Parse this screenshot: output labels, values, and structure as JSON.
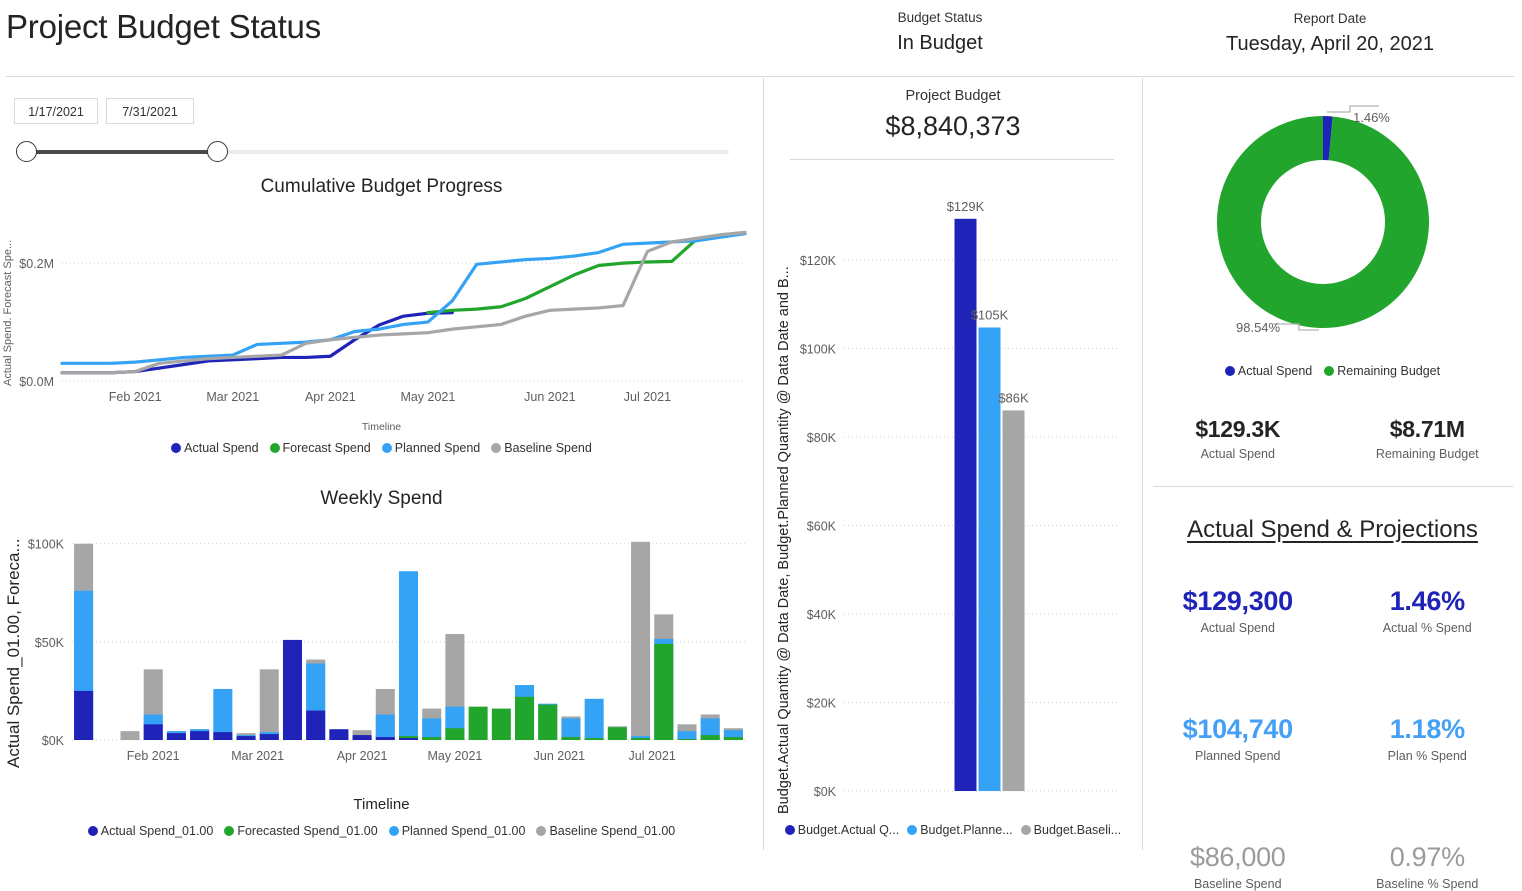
{
  "header": {
    "title": "Project Budget Status",
    "budget_status_label": "Budget Status",
    "budget_status_value": "In Budget",
    "report_date_label": "Report Date",
    "report_date_value": "Tuesday, April 20, 2021"
  },
  "slicer": {
    "start_date": "1/17/2021",
    "end_date": "7/31/2021"
  },
  "colors": {
    "actual": "#1f23b8",
    "forecast": "#21a52c",
    "planned": "#34a3f5",
    "baseline": "#a6a6a6",
    "text": "#252423",
    "muted": "#605e5c"
  },
  "middle": {
    "kpi_label": "Project Budget",
    "kpi_value": "$8,840,373"
  },
  "right": {
    "donut_label_top": "1.46%",
    "donut_label_bottom": "98.54%",
    "kpi_top": [
      {
        "value": "$129.3K",
        "label": "Actual Spend"
      },
      {
        "value": "$8.71M",
        "label": "Remaining Budget"
      }
    ],
    "projections_title": "Actual Spend & Projections",
    "projections": [
      [
        {
          "value": "$129,300",
          "label": "Actual Spend"
        },
        {
          "value": "1.46%",
          "label": "Actual % Spend"
        }
      ],
      [
        {
          "value": "$104,740",
          "label": "Planned Spend"
        },
        {
          "value": "1.18%",
          "label": "Plan % Spend"
        }
      ],
      [
        {
          "value": "$86,000",
          "label": "Baseline Spend"
        },
        {
          "value": "0.97%",
          "label": "Baseline % Spend"
        }
      ]
    ]
  },
  "chart_data": [
    {
      "id": "cumulative",
      "type": "line",
      "title": "Cumulative Budget Progress",
      "xlabel": "Timeline",
      "ylabel": "Actual Spend. Forecast Spe...",
      "x_ticks": [
        "Feb 2021",
        "Mar 2021",
        "Apr 2021",
        "May 2021",
        "Jun 2021",
        "Jul 2021"
      ],
      "y_ticks": [
        "$0.0M",
        "$0.2M"
      ],
      "ylim": [
        0,
        280000
      ],
      "y_tick_values": [
        0,
        200000
      ],
      "grid": true,
      "legend_position": "bottom",
      "x": [
        "2021-01-17",
        "2021-01-24",
        "2021-01-31",
        "2021-02-07",
        "2021-02-14",
        "2021-02-21",
        "2021-02-28",
        "2021-03-07",
        "2021-03-14",
        "2021-03-21",
        "2021-03-28",
        "2021-04-04",
        "2021-04-11",
        "2021-04-18",
        "2021-04-25",
        "2021-05-02",
        "2021-05-09",
        "2021-05-16",
        "2021-05-23",
        "2021-05-30",
        "2021-06-06",
        "2021-06-13",
        "2021-06-20",
        "2021-06-27",
        "2021-07-04",
        "2021-07-11",
        "2021-07-18",
        "2021-07-25",
        "2021-07-31"
      ],
      "series": [
        {
          "name": "Actual Spend",
          "color": "#1f23b8",
          "values": [
            14000,
            14000,
            14000,
            16000,
            22000,
            28000,
            34000,
            36000,
            38000,
            40000,
            40000,
            42000,
            70000,
            95000,
            110000,
            115000,
            116000,
            null,
            null,
            null,
            null,
            null,
            null,
            null,
            null,
            null,
            null,
            null,
            null
          ]
        },
        {
          "name": "Forecast Spend",
          "color": "#21a52c",
          "values": [
            null,
            null,
            null,
            null,
            null,
            null,
            null,
            null,
            null,
            null,
            null,
            null,
            null,
            null,
            null,
            116000,
            120000,
            122000,
            126000,
            140000,
            160000,
            180000,
            196000,
            200000,
            202000,
            203000,
            240000,
            248000,
            252000
          ]
        },
        {
          "name": "Planned Spend",
          "color": "#34a3f5",
          "values": [
            30000,
            30000,
            30000,
            32000,
            36000,
            40000,
            42000,
            44000,
            62000,
            64000,
            66000,
            70000,
            84000,
            88000,
            96000,
            100000,
            136000,
            198000,
            202000,
            206000,
            208000,
            212000,
            218000,
            232000,
            234000,
            236000,
            238000,
            244000,
            250000
          ],
          "note": "cumulative planned spend curve"
        },
        {
          "name": "Baseline Spend",
          "color": "#a6a6a6",
          "values": [
            14000,
            14000,
            14000,
            16000,
            30000,
            34000,
            38000,
            40000,
            42000,
            44000,
            64000,
            70000,
            74000,
            78000,
            80000,
            82000,
            88000,
            92000,
            96000,
            110000,
            120000,
            122000,
            124000,
            128000,
            220000,
            236000,
            242000,
            248000,
            252000
          ]
        }
      ]
    },
    {
      "id": "weekly",
      "type": "bar",
      "stacked_overlap": true,
      "title": "Weekly Spend",
      "xlabel": "Timeline",
      "ylabel": "Actual Spend_01.00, Foreca...",
      "x_ticks": [
        "Feb 2021",
        "Mar 2021",
        "Apr 2021",
        "May 2021",
        "Jun 2021",
        "Jul 2021"
      ],
      "y_ticks": [
        "$0K",
        "$50K",
        "$100K"
      ],
      "y_tick_values": [
        0,
        50000,
        100000
      ],
      "ylim": [
        0,
        107000
      ],
      "grid": true,
      "legend_position": "bottom",
      "categories": [
        "Jan 17",
        "Jan 24",
        "Jan 31",
        "Feb 7",
        "Feb 14",
        "Feb 21",
        "Feb 28",
        "Mar 7",
        "Mar 14",
        "Mar 21",
        "Mar 28",
        "Apr 4",
        "Apr 11",
        "Apr 18",
        "Apr 25",
        "May 2",
        "May 9",
        "May 16",
        "May 23",
        "May 30",
        "Jun 6",
        "Jun 13",
        "Jun 20",
        "Jun 27",
        "Jul 4",
        "Jul 11",
        "Jul 18",
        "Jul 25",
        "Jul 31"
      ],
      "series": [
        {
          "name": "Actual Spend_01.00",
          "color": "#1f23b8",
          "values": [
            25000,
            0,
            0,
            8000,
            3500,
            4500,
            4000,
            2000,
            3000,
            51000,
            15000,
            5500,
            2500,
            1500,
            1000,
            0,
            0,
            0,
            0,
            0,
            0,
            0,
            0,
            0,
            0,
            0,
            0,
            0,
            0
          ]
        },
        {
          "name": "Forecasted Spend_01.00",
          "color": "#21a52c",
          "values": [
            0,
            0,
            0,
            0,
            0,
            0,
            0,
            0,
            0,
            0,
            0,
            0,
            0,
            0,
            2000,
            1500,
            6000,
            17000,
            16000,
            22000,
            18000,
            1500,
            1000,
            6500,
            1000,
            49000,
            500,
            2500,
            1500
          ]
        },
        {
          "name": "Planned Spend_01.00",
          "color": "#34a3f5",
          "values": [
            76000,
            0,
            0,
            13000,
            4500,
            5500,
            26000,
            2500,
            4000,
            0,
            39000,
            0,
            2000,
            13000,
            86000,
            11000,
            17000,
            0,
            0,
            28000,
            18500,
            11000,
            21000,
            0,
            2000,
            51500,
            4500,
            11000,
            5000
          ]
        },
        {
          "name": "Baseline Spend_01.00",
          "color": "#a6a6a6",
          "values": [
            100000,
            0,
            4500,
            36000,
            4500,
            5500,
            0,
            3500,
            36000,
            0,
            41000,
            4500,
            5000,
            26000,
            0,
            16000,
            54000,
            0,
            0,
            0,
            0,
            12000,
            0,
            7000,
            101000,
            64000,
            8000,
            13000,
            6000
          ]
        }
      ]
    },
    {
      "id": "budget-compare",
      "type": "bar",
      "title": "",
      "ylabel": "Budget.Actual Quantity @ Data Date, Budget.Planned Quantity @ Data Date and B...",
      "y_ticks": [
        "$0K",
        "$20K",
        "$40K",
        "$60K",
        "$80K",
        "$100K",
        "$120K"
      ],
      "y_tick_values": [
        0,
        20000,
        40000,
        60000,
        80000,
        100000,
        120000
      ],
      "ylim": [
        0,
        134000
      ],
      "grid": true,
      "legend_position": "bottom",
      "categories": [
        ""
      ],
      "series": [
        {
          "name": "Budget.Actual Q...",
          "color": "#1f23b8",
          "values": [
            129300
          ],
          "data_label": "$129K"
        },
        {
          "name": "Budget.Planne...",
          "color": "#34a3f5",
          "values": [
            104740
          ],
          "data_label": "$105K"
        },
        {
          "name": "Budget.Baseli...",
          "color": "#a6a6a6",
          "values": [
            86000
          ],
          "data_label": "$86K"
        }
      ]
    },
    {
      "id": "budget-donut",
      "type": "pie",
      "donut": true,
      "title": "",
      "legend_position": "bottom",
      "labels": [
        "Actual Spend",
        "Remaining Budget"
      ],
      "values": [
        1.46,
        98.54
      ],
      "value_labels": [
        "1.46%",
        "98.54%"
      ],
      "colors": [
        "#1f23b8",
        "#21a52c"
      ]
    }
  ]
}
